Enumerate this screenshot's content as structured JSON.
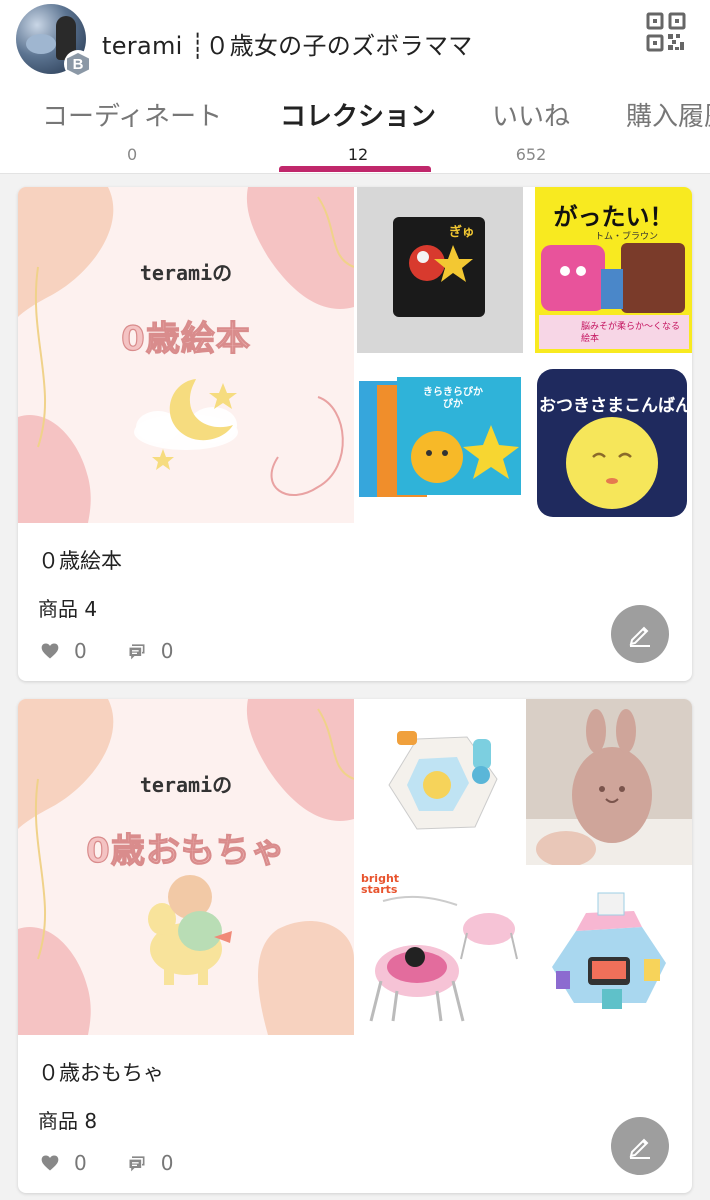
{
  "profile": {
    "username": "terami ┊０歳女の子のズボラママ",
    "badge_letter": "B"
  },
  "tabs": [
    {
      "label": "コーディネート",
      "count": "0"
    },
    {
      "label": "コレクション",
      "count": "12"
    },
    {
      "label": "いいね",
      "count": "652"
    },
    {
      "label": "購入履歴",
      "count": ""
    }
  ],
  "collections": [
    {
      "cover_small": "teramiの",
      "cover_big": "0歳絵本",
      "title": "０歳絵本",
      "items_count": "商品 4",
      "likes": "0",
      "comments": "0",
      "thumb_texts": [
        "ぎゅ",
        "がったい！",
        "トム・ブラウン",
        "脳みそが柔らか〜くなる絵本",
        "きらきらぴかぴか",
        "おつきさまこんばんは"
      ]
    },
    {
      "cover_small": "teramiの",
      "cover_big": "0歳おもちゃ",
      "title": "０歳おもちゃ",
      "items_count": "商品 8",
      "likes": "0",
      "comments": "0",
      "thumb_texts": [
        "bright starts"
      ]
    }
  ],
  "colors": {
    "accent": "#c0276b",
    "cover_bg": "#fdf1ef",
    "edit_button": "#9e9e9e"
  },
  "icons": [
    "qr-code-icon",
    "heart-icon",
    "comment-icon",
    "pencil-icon"
  ]
}
